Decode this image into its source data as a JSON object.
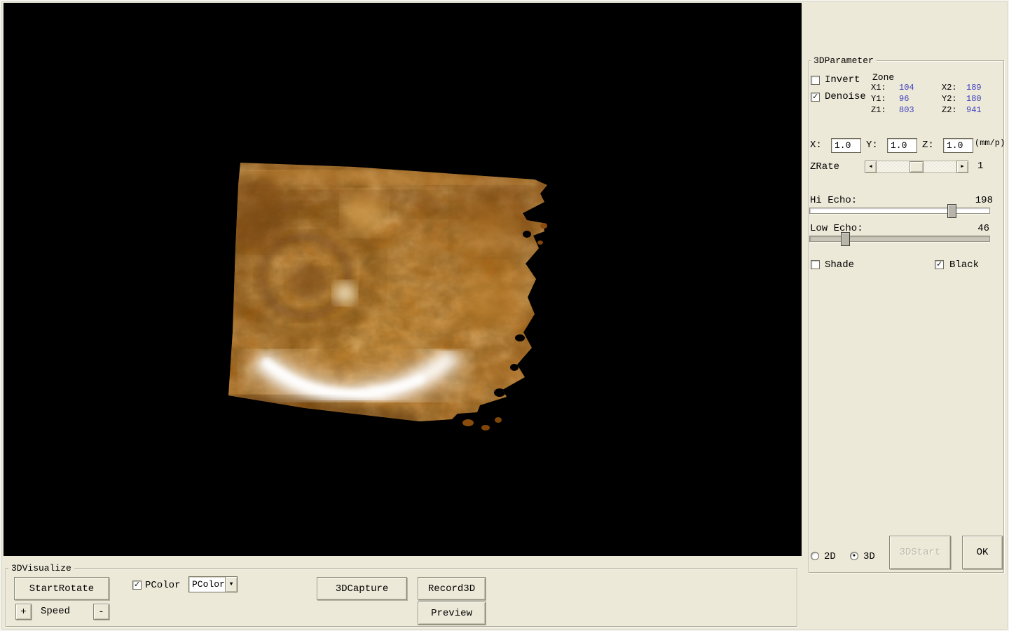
{
  "window": {
    "bg_color": "#ece9d8",
    "viewport_bg": "#000000"
  },
  "parameter_panel": {
    "title": "3DParameter",
    "invert": {
      "label": "Invert",
      "checked": false,
      "mark": ""
    },
    "denoise": {
      "label": "Denoise",
      "checked": true,
      "mark": "✓"
    },
    "zone": {
      "title": "Zone",
      "value_color": "#3f3fbf",
      "rows": [
        {
          "label1": "X1:",
          "value1": "104",
          "label2": "X2:",
          "value2": "189"
        },
        {
          "label1": "Y1:",
          "value1": "96",
          "label2": "Y2:",
          "value2": "180"
        },
        {
          "label1": "Z1:",
          "value1": "803",
          "label2": "Z2:",
          "value2": "941"
        }
      ]
    },
    "scale": {
      "x_label": "X:",
      "x_value": "1.0",
      "y_label": "Y:",
      "y_value": "1.0",
      "z_label": "Z:",
      "z_value": "1.0",
      "unit": "(mm/p)"
    },
    "zrate": {
      "label": "ZRate",
      "value": "1"
    },
    "hi_echo": {
      "label": "Hi Echo:",
      "value": "198"
    },
    "low_echo": {
      "label": "Low Echo:",
      "value": "46"
    },
    "shade": {
      "label": "Shade",
      "checked": false,
      "mark": ""
    },
    "black": {
      "label": "Black",
      "checked": true,
      "mark": "✓"
    },
    "mode": {
      "d2": {
        "label": "2D",
        "selected": false,
        "mark": ""
      },
      "d3": {
        "label": "3D",
        "selected": true,
        "mark": "●"
      }
    },
    "buttons": {
      "start3d": "3DStart",
      "ok": "OK"
    }
  },
  "visualize_panel": {
    "title": "3DVisualize",
    "start_rotate": "StartRotate",
    "speed": {
      "plus": "+",
      "label": "Speed",
      "minus": "-"
    },
    "pcolor": {
      "label": "PColor",
      "checked": true,
      "mark": "✓"
    },
    "pcolor_dropdown": {
      "value": "PColor",
      "arrow": "▼"
    },
    "capture": "3DCapture",
    "record": "Record3D",
    "preview": "Preview"
  }
}
